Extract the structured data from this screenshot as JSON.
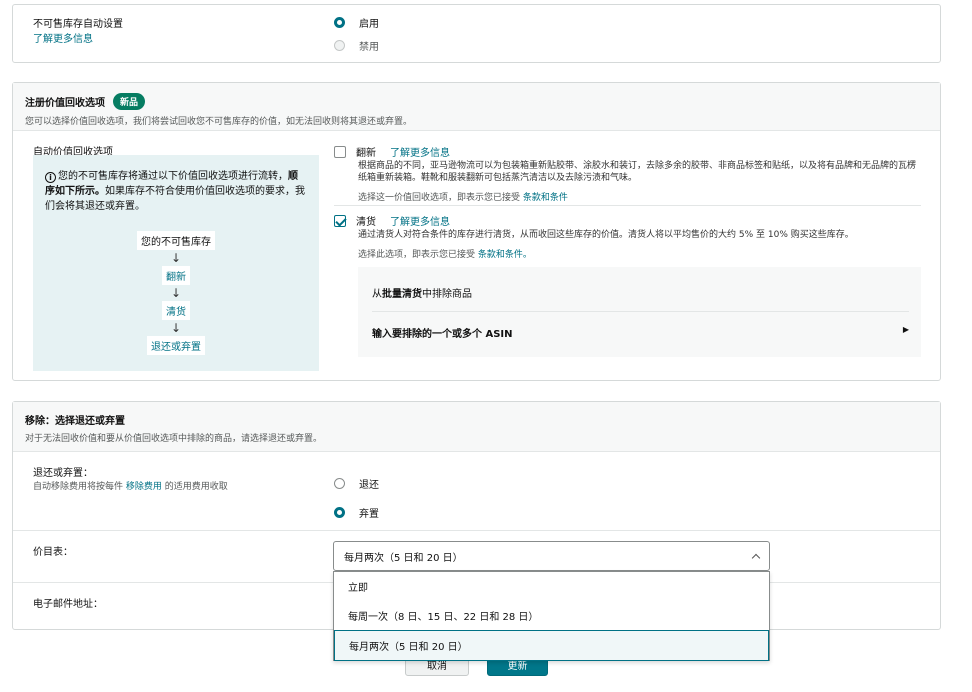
{
  "unsellable": {
    "label": "不可售库存自动设置",
    "learn_more": "了解更多信息",
    "options": [
      "启用",
      "禁用"
    ],
    "selected": 0
  },
  "recovery": {
    "title": "注册价值回收选项",
    "badge": "新品",
    "subtitle": "您可以选择价值回收选项，我们将尝试回收您不可售库存的价值，如无法回收则将其退还或弃置。",
    "auto_label": "自动价值回收选项",
    "flow_intro_1": "您的不可售库存将通过以下价值回收选项进行流转，",
    "flow_intro_bold": "顺序如下所示。",
    "flow_intro_2": "如果库存不符合使用价值回收选项的要求，我们会将其退还或弃置。",
    "flow_steps": [
      "您的不可售库存",
      "翻新",
      "清货",
      "退还或弃置"
    ],
    "flow_arrow": "↓",
    "refurb": {
      "title": "翻新",
      "learn_more": "了解更多信息",
      "desc": "根据商品的不同，亚马逊物流可以为包装箱重新贴胶带、涂胶水和装订，去除多余的胶带、非商品标签和贴纸，以及将有品牌和无品牌的瓦楞纸箱重新装箱。鞋靴和服装翻新可包括蒸汽清洁以及去除污渍和气味。",
      "terms_prefix": "选择这一价值回收选项，即表示您已接受",
      "terms_link": "条款和条件",
      "checked": false
    },
    "liquidation": {
      "title": "清货",
      "learn_more": "了解更多信息",
      "desc": "通过清货人对符合条件的库存进行清货，从而收回这些库存的价值。清货人将以平均售价的大约 5% 至 10% 购买这些库存。",
      "terms_prefix": "选择此选项，即表示您已接受",
      "terms_link": "条款和条件。",
      "checked": true
    },
    "exclude": {
      "prefix": "从",
      "bold": "批量清货",
      "suffix": "中排除商品",
      "asin_label": "输入要排除的一个或多个 ASIN",
      "arrow": "▶"
    }
  },
  "removal": {
    "title": "移除：选择退还或弃置",
    "subtitle": "对于无法回收价值和要从价值回收选项中排除的商品，请选择退还或弃置。",
    "return_label": "退还或弃置：",
    "fee_prefix": "自动移除费用将按每件",
    "fee_link": "移除费用",
    "fee_suffix": "的适用费用收取",
    "options": [
      "退还",
      "弃置"
    ],
    "selected": 1,
    "schedule_label": "价目表：",
    "schedule_value": "每月两次（5 日和 20 日）",
    "schedule_caret": "^",
    "schedule_options": [
      "立即",
      "每周一次（8 日、15 日、22 日和 28 日）",
      "每月两次（5 日和 20 日）"
    ],
    "email_label": "电子邮件地址："
  },
  "buttons": {
    "cancel": "取消",
    "update": "更新"
  }
}
